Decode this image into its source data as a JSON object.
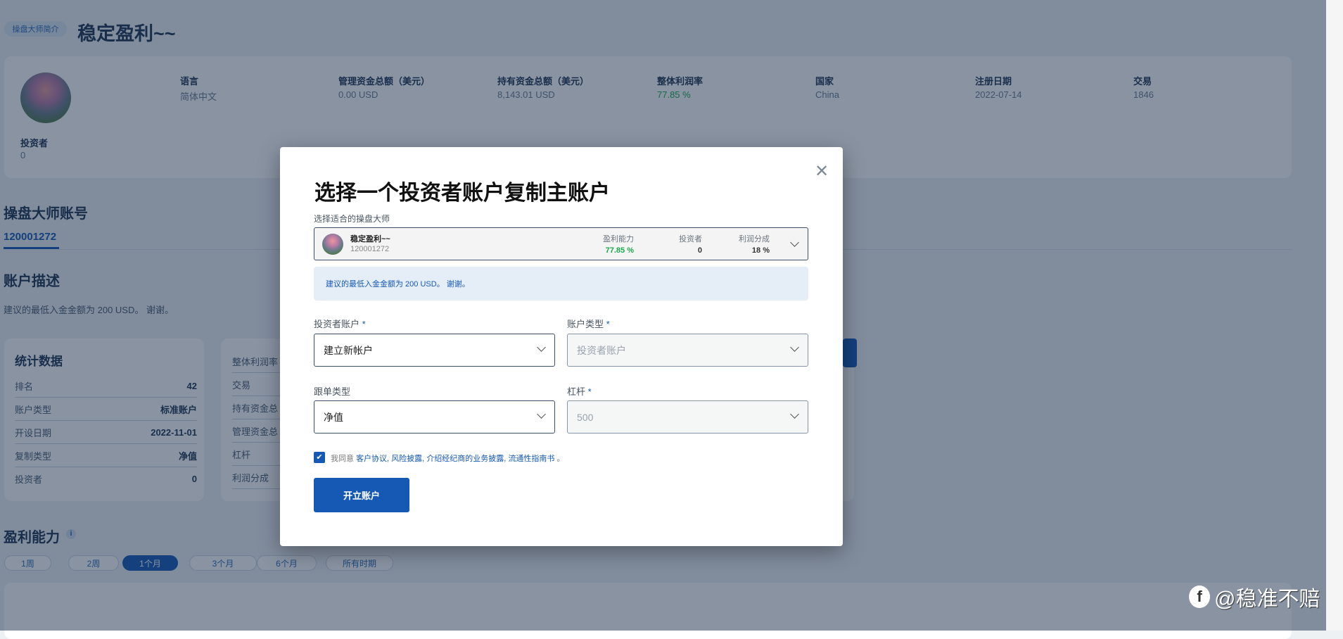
{
  "header": {
    "badge": "操盘大师简介",
    "title": "稳定盈利~~"
  },
  "profile": {
    "investors_label": "投资者",
    "investors_value": "0",
    "columns": [
      {
        "label": "语言",
        "value": "简体中文"
      },
      {
        "label": "管理资金总额（美元）",
        "value": "0.00 USD"
      },
      {
        "label": "持有资金总额（美元）",
        "value": "8,143.01 USD"
      },
      {
        "label": "整体利润率",
        "value": "77.85 %"
      },
      {
        "label": "国家",
        "value": "China"
      },
      {
        "label": "注册日期",
        "value": "2022-07-14"
      },
      {
        "label": "交易",
        "value": "1846"
      }
    ]
  },
  "accounts": {
    "title": "操盘大师账号",
    "tab": "120001272"
  },
  "description": {
    "title": "账户描述",
    "text": "建议的最低入金金额为 200 USD。 谢谢。"
  },
  "stats": {
    "title": "统计数据",
    "rows": [
      {
        "k": "排名",
        "v": "42"
      },
      {
        "k": "账户类型",
        "v": "标准账户"
      },
      {
        "k": "开设日期",
        "v": "2022-11-01"
      },
      {
        "k": "复制类型",
        "v": "净值"
      },
      {
        "k": "投资者",
        "v": "0"
      }
    ],
    "rows2": [
      "整体利润率",
      "交易",
      "持有资金总",
      "管理资金总",
      "杠杆",
      "利润分成"
    ]
  },
  "profitability": {
    "title": "盈利能力",
    "periods": [
      "1周",
      "2周",
      "1个月",
      "3个月",
      "6个月",
      "所有时期"
    ],
    "active": "1个月"
  },
  "modal": {
    "title": "选择一个投资者账户复制主账户",
    "master_label": "选择适合的操盘大师",
    "master": {
      "name": "稳定盈利~~",
      "id": "120001272",
      "profit_label": "盈利能力",
      "profit": "77.85 %",
      "investors_label": "投资者",
      "investors": "0",
      "share_label": "利润分成",
      "share": "18 %"
    },
    "info": "建议的最低入金金额为 200 USD。 谢谢。",
    "investor_account_label": "投资者账户",
    "investor_account_value": "建立新帐户",
    "account_type_label": "账户类型",
    "account_type_value": "投资者账户",
    "copy_type_label": "跟单类型",
    "copy_type_value": "净值",
    "leverage_label": "杠杆",
    "leverage_value": "500",
    "required": "*",
    "agree_prefix": "我同意",
    "agree_links": [
      "客户协议,",
      "风险披露,",
      "介绍经纪商的业务披露,",
      "流通性指南书"
    ],
    "agree_suffix": "。",
    "submit": "开立账户",
    "close": "✕"
  },
  "watermark": "@稳准不赔",
  "colors": {
    "accent": "#1559b5",
    "profit": "#1aa84a"
  }
}
